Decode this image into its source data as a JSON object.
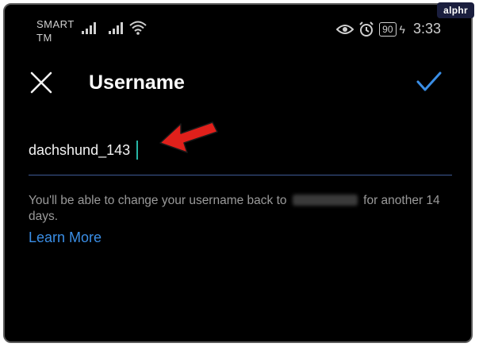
{
  "status_bar": {
    "carrier_line1": "SMART",
    "carrier_line2": "TM",
    "battery": "90",
    "time": "3:33"
  },
  "brand": "alphr",
  "header": {
    "title": "Username",
    "close_icon": "close-icon",
    "confirm_icon": "check-icon"
  },
  "username_field": {
    "value": "dachshund_143"
  },
  "helper": {
    "text_before": "You'll be able to change your username back to",
    "text_after": "for another 14 days.",
    "link": "Learn More"
  },
  "colors": {
    "background": "#000000",
    "accent_blue": "#3a8ee6",
    "underline": "#3e5a96",
    "annotation_arrow": "#e0201b"
  }
}
